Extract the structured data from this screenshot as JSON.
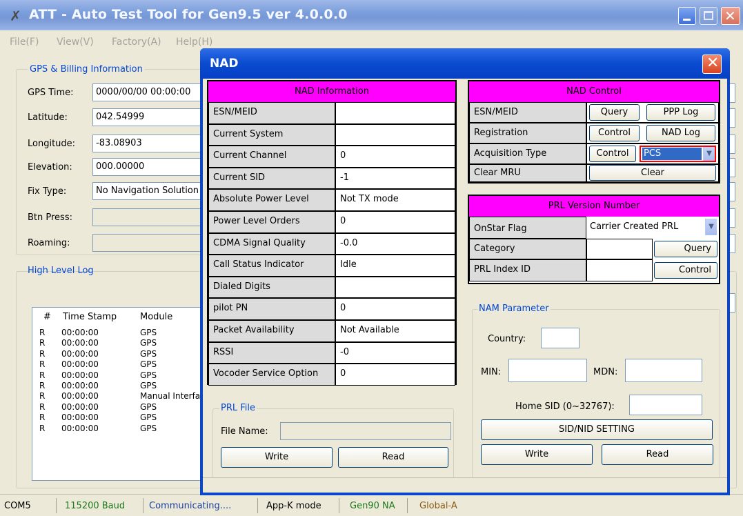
{
  "main": {
    "title": "ATT - Auto Test Tool for Gen9.5 ver 4.0.0.0",
    "menu": [
      "File(F)",
      "View(V)",
      "Factory(A)",
      "Help(H)"
    ]
  },
  "gps": {
    "group_title": "GPS & Billing Information",
    "rows": [
      {
        "label": "GPS Time:",
        "value": "0000/00/00 00:00:00"
      },
      {
        "label": "Latitude:",
        "value": "042.54999"
      },
      {
        "label": "Longitude:",
        "value": "-83.08903"
      },
      {
        "label": "Elevation:",
        "value": "000.00000"
      },
      {
        "label": "Fix Type:",
        "value": "No Navigation Solution"
      },
      {
        "label": "Btn Press:",
        "value": ""
      },
      {
        "label": "Roaming:",
        "value": ""
      }
    ]
  },
  "log": {
    "group_title": "High Level Log",
    "headers": [
      "#",
      "Time Stamp",
      "Module"
    ],
    "rows": [
      {
        "n": "R",
        "time": "00:00:00",
        "module": "GPS"
      },
      {
        "n": "R",
        "time": "00:00:00",
        "module": "GPS"
      },
      {
        "n": "R",
        "time": "00:00:00",
        "module": "GPS"
      },
      {
        "n": "R",
        "time": "00:00:00",
        "module": "GPS"
      },
      {
        "n": "R",
        "time": "00:00:00",
        "module": "GPS"
      },
      {
        "n": "R",
        "time": "00:00:00",
        "module": "GPS"
      },
      {
        "n": "R",
        "time": "00:00:00",
        "module": "Manual Interface"
      },
      {
        "n": "R",
        "time": "00:00:00",
        "module": "GPS"
      },
      {
        "n": "R",
        "time": "00:00:00",
        "module": "GPS"
      },
      {
        "n": "R",
        "time": "00:00:00",
        "module": "GPS"
      }
    ]
  },
  "status": [
    "COM5",
    "115200 Baud",
    "Communicating....",
    "App-K mode",
    "Gen90 NA",
    "Global-A"
  ],
  "status_colors": [
    "#000000",
    "#1a7a1a",
    "#1a3fa0",
    "#000000",
    "#1a7a1a",
    "#8a5a10"
  ],
  "nad": {
    "title": "NAD",
    "info": {
      "header": "NAD Information",
      "rows": [
        {
          "label": "ESN/MEID",
          "value": ""
        },
        {
          "label": "Current System",
          "value": ""
        },
        {
          "label": "Current Channel",
          "value": "0"
        },
        {
          "label": "Current SID",
          "value": "-1"
        },
        {
          "label": "Absolute Power Level",
          "value": "Not TX mode"
        },
        {
          "label": "Power Level Orders",
          "value": "0"
        },
        {
          "label": "CDMA Signal Quality",
          "value": "-0.0"
        },
        {
          "label": "Call Status Indicator",
          "value": "Idle"
        },
        {
          "label": "Dialed Digits",
          "value": ""
        },
        {
          "label": "pilot PN",
          "value": "0"
        },
        {
          "label": "Packet Availability",
          "value": "Not Available"
        },
        {
          "label": "RSSI",
          "value": "-0"
        },
        {
          "label": "Vocoder Service Option",
          "value": "0"
        }
      ]
    },
    "control": {
      "header": "NAD Control",
      "rows": [
        {
          "label": "ESN/MEID",
          "btn1": "Query",
          "btn2": "PPP Log"
        },
        {
          "label": "Registration",
          "btn1": "Control",
          "btn2": "NAD Log"
        },
        {
          "label": "Acquisition Type",
          "btn1": "Control",
          "select": "PCS"
        },
        {
          "label": "Clear MRU",
          "btn_wide": "Clear"
        }
      ]
    },
    "prl": {
      "header": "PRL Version Number",
      "rows": [
        {
          "label": "OnStar Flag",
          "select": "Carrier Created PRL"
        },
        {
          "label": "Category",
          "btn": "Query"
        },
        {
          "label": "PRL Index ID",
          "btn": "Control"
        }
      ]
    },
    "prl_file": {
      "group_title": "PRL File",
      "file_label": "File Name:",
      "file_value": "",
      "write": "Write",
      "read": "Read"
    },
    "nam": {
      "group_title": "NAM Parameter",
      "country_label": "Country:",
      "min_label": "MIN:",
      "mdn_label": "MDN:",
      "home_sid_label": "Home SID (0~32767):",
      "sid_nid_btn": "SID/NID SETTING",
      "write": "Write",
      "read": "Read"
    }
  }
}
